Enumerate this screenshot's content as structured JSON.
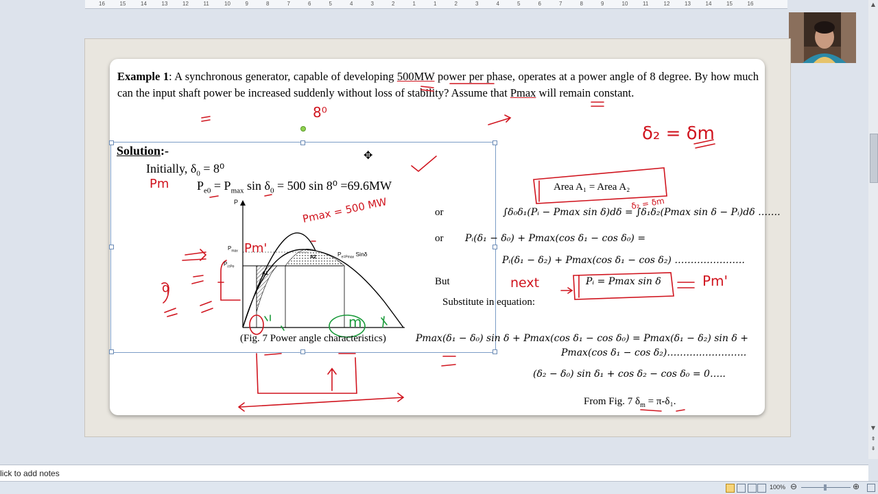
{
  "ruler": {
    "marks": [
      "16",
      "15",
      "14",
      "13",
      "12",
      "11",
      "10",
      "9",
      "8",
      "7",
      "6",
      "5",
      "4",
      "3",
      "2",
      "1",
      "1",
      "2",
      "3",
      "4",
      "5",
      "6",
      "7",
      "8",
      "9",
      "10",
      "11",
      "12",
      "13",
      "14",
      "15",
      "16"
    ]
  },
  "example": {
    "label": "Example 1",
    "p1": ": A synchronous generator, capable of developing ",
    "power": "500MW",
    "p2": " power per phase, operates at a power angle of 8 degree. By how much can the input shaft power be increased suddenly without loss of stability? Assume that ",
    "pmax": "Pmax",
    "p3": " will remain constant."
  },
  "solution": {
    "heading": "Solution",
    "suffix": ":-",
    "initially": "Initially, δ",
    "initially_sub": "0",
    "initially_val": " = 8⁰",
    "pe0_eq": "P",
    "pe0_sub": "e0",
    "pe0_rhs": "= P",
    "pe0_rhs_sub": "max",
    "pe0_tail": " sin δ",
    "pe0_tail_sub": "0",
    "pe0_end": " = 500 sin 8⁰ =69.6MW",
    "fig_caption": "(Fig. 7 Power angle characteristics)"
  },
  "figure": {
    "y_axis": "P",
    "pmax_label": "P",
    "pmax_sub": "max",
    "pi_label": "P",
    "pi_sub": "i=Pe",
    "curve_label": "P",
    "curve_sub": "e=Pmax",
    "curve_tail": " Sinδ",
    "a1": "A1",
    "a2": "A2"
  },
  "equations": {
    "area_box": "Area A₁ = Area A₂",
    "or1": "or",
    "int_eq": "∫δ₀δ₁(Pᵢ − Pmax sin δ)dδ = ∫δ₁δ₂(Pmax sin δ − Pᵢ)dδ …….",
    "or2": "or",
    "line2a": "Pᵢ(δ₁ − δ₀) + Pmax(cos δ₁ − cos δ₀) =",
    "line2b": "Pᵢ(δ₁ − δ₂) + Pmax(cos δ₁ − cos δ₂) ………………….",
    "but": "But",
    "pi_box": "Pᵢ = Pmax sin δ",
    "substitute": "Substitute in equation:",
    "line3a": "Pmax(δ₁ − δ₀) sin δ + Pmax(cos δ₁ − cos δ₀) = Pmax(δ₁ − δ₂) sin δ +",
    "line3b": "Pmax(cos δ₁ − cos δ₂)………..…………..",
    "line4": "(δ₂ − δ₀) sin δ₁ + cos δ₂ − cos δ₀ = 0…..",
    "fig_ref": "From Fig. 7 δ",
    "fig_ref_sub": "m",
    "fig_ref_tail": " = π-δ₁."
  },
  "annotations": {
    "eight": "8⁰",
    "delta2": "δ₂ = δm",
    "pm": "Pm",
    "pmax_val": "Pmax = 500 MW",
    "pm_prime": "Pm'",
    "next": "next",
    "pm_prime2": "Pm'",
    "delta_m": "δ₂ = δm",
    "m_circle": "m",
    "q": "q"
  },
  "notes": {
    "placeholder": "lick to add notes"
  },
  "status": {
    "zoom": "100%"
  }
}
